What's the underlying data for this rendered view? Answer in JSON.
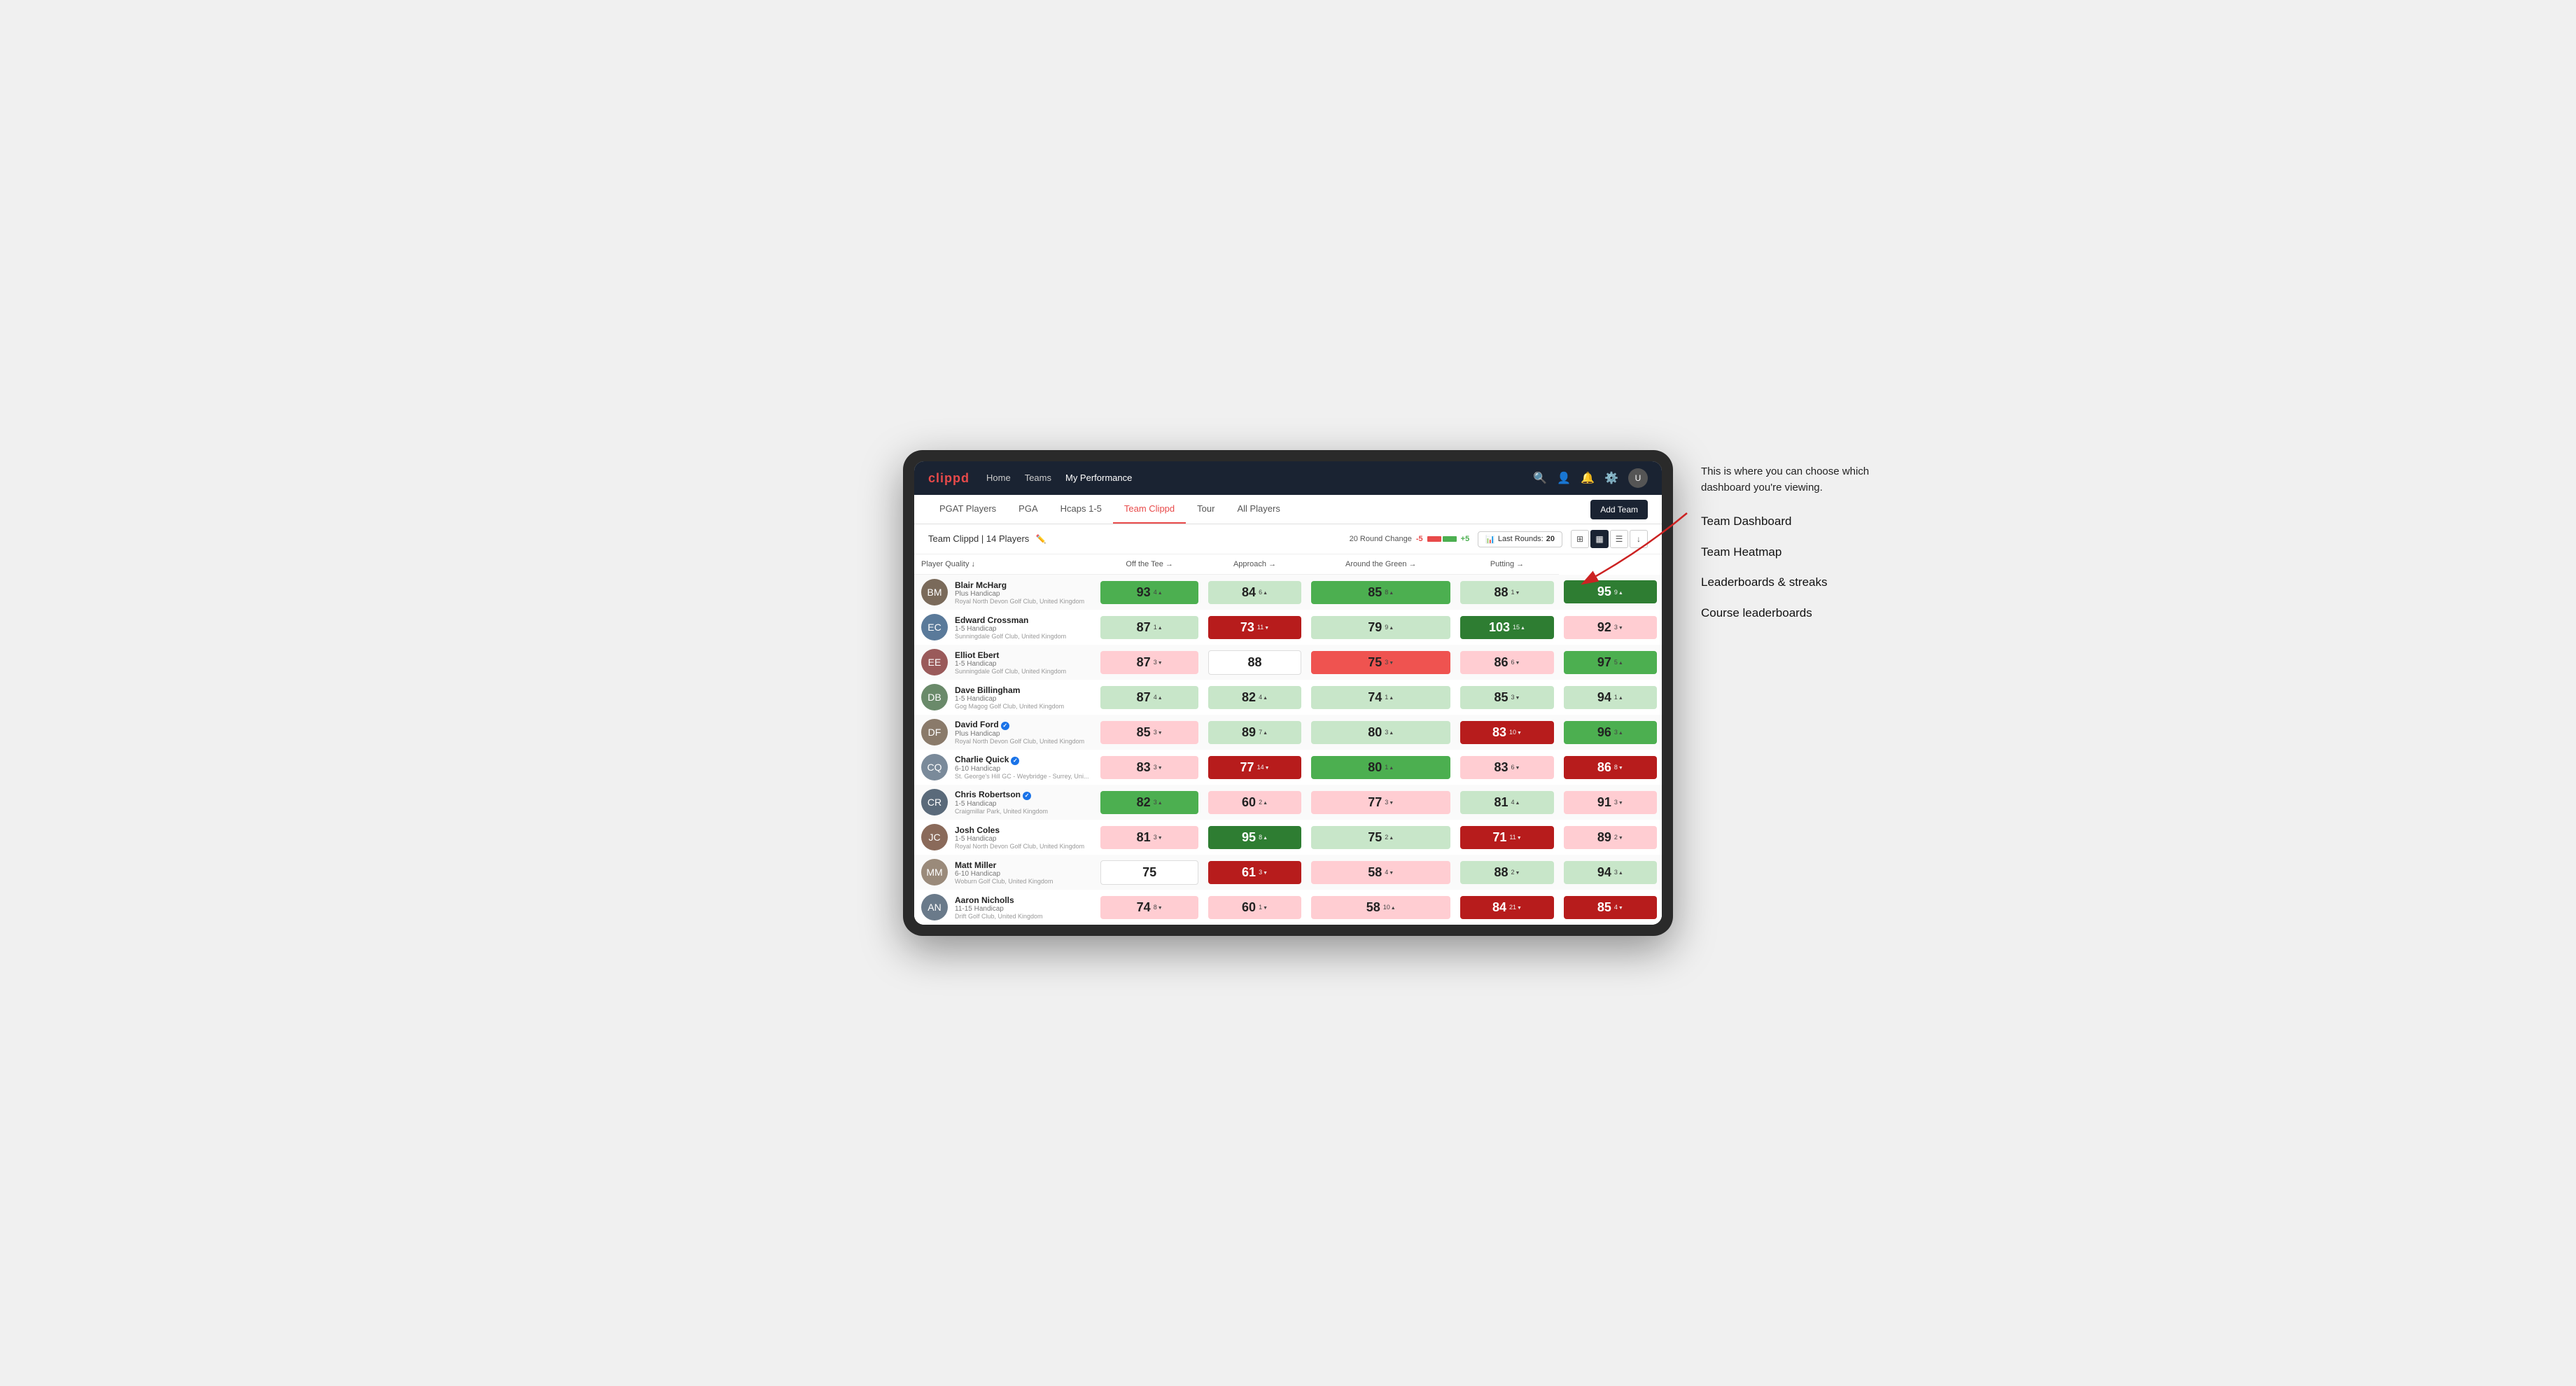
{
  "annotation": {
    "intro": "This is where you can choose which dashboard you're viewing.",
    "items": [
      "Team Dashboard",
      "Team Heatmap",
      "Leaderboards & streaks",
      "Course leaderboards"
    ]
  },
  "nav": {
    "logo": "clippd",
    "links": [
      "Home",
      "Teams",
      "My Performance"
    ],
    "active_link": "My Performance"
  },
  "sub_tabs": [
    "PGAT Players",
    "PGA",
    "Hcaps 1-5",
    "Team Clippd",
    "Tour",
    "All Players"
  ],
  "active_tab": "Team Clippd",
  "add_team_label": "Add Team",
  "team_header": {
    "name": "Team Clippd",
    "player_count": "14 Players",
    "round_change_label": "20 Round Change",
    "change_min": "-5",
    "change_max": "+5",
    "last_rounds_label": "Last Rounds:",
    "last_rounds_value": "20"
  },
  "table_headers": {
    "player": "Player Quality ↓",
    "off_tee": "Off the Tee →",
    "approach": "Approach →",
    "around_green": "Around the Green →",
    "putting": "Putting →"
  },
  "players": [
    {
      "name": "Blair McHarg",
      "handicap": "Plus Handicap",
      "club": "Royal North Devon Golf Club, United Kingdom",
      "avatar_color": "#7a6a5a",
      "player_quality": {
        "score": 93,
        "delta": 4,
        "dir": "up",
        "color": "green"
      },
      "off_tee": {
        "score": 84,
        "delta": 6,
        "dir": "up",
        "color": "light-green"
      },
      "approach": {
        "score": 85,
        "delta": 8,
        "dir": "up",
        "color": "green"
      },
      "around_green": {
        "score": 88,
        "delta": 1,
        "dir": "down",
        "color": "light-green"
      },
      "putting": {
        "score": 95,
        "delta": 9,
        "dir": "up",
        "color": "dark-green"
      }
    },
    {
      "name": "Edward Crossman",
      "handicap": "1-5 Handicap",
      "club": "Sunningdale Golf Club, United Kingdom",
      "avatar_color": "#5a7a9a",
      "player_quality": {
        "score": 87,
        "delta": 1,
        "dir": "up",
        "color": "light-green"
      },
      "off_tee": {
        "score": 73,
        "delta": 11,
        "dir": "down",
        "color": "dark-red"
      },
      "approach": {
        "score": 79,
        "delta": 9,
        "dir": "up",
        "color": "light-green"
      },
      "around_green": {
        "score": 103,
        "delta": 15,
        "dir": "up",
        "color": "dark-green"
      },
      "putting": {
        "score": 92,
        "delta": 3,
        "dir": "down",
        "color": "light-red"
      }
    },
    {
      "name": "Elliot Ebert",
      "handicap": "1-5 Handicap",
      "club": "Sunningdale Golf Club, United Kingdom",
      "avatar_color": "#9a5a5a",
      "player_quality": {
        "score": 87,
        "delta": 3,
        "dir": "down",
        "color": "light-red"
      },
      "off_tee": {
        "score": 88,
        "delta": null,
        "dir": null,
        "color": "white"
      },
      "approach": {
        "score": 75,
        "delta": 3,
        "dir": "down",
        "color": "red"
      },
      "around_green": {
        "score": 86,
        "delta": 6,
        "dir": "down",
        "color": "light-red"
      },
      "putting": {
        "score": 97,
        "delta": 5,
        "dir": "up",
        "color": "green"
      }
    },
    {
      "name": "Dave Billingham",
      "handicap": "1-5 Handicap",
      "club": "Gog Magog Golf Club, United Kingdom",
      "avatar_color": "#6a8a6a",
      "player_quality": {
        "score": 87,
        "delta": 4,
        "dir": "up",
        "color": "light-green"
      },
      "off_tee": {
        "score": 82,
        "delta": 4,
        "dir": "up",
        "color": "light-green"
      },
      "approach": {
        "score": 74,
        "delta": 1,
        "dir": "up",
        "color": "light-green"
      },
      "around_green": {
        "score": 85,
        "delta": 3,
        "dir": "down",
        "color": "light-green"
      },
      "putting": {
        "score": 94,
        "delta": 1,
        "dir": "up",
        "color": "light-green"
      }
    },
    {
      "name": "David Ford",
      "handicap": "Plus Handicap",
      "club": "Royal North Devon Golf Club, United Kingdom",
      "avatar_color": "#8a7a6a",
      "verified": true,
      "player_quality": {
        "score": 85,
        "delta": 3,
        "dir": "down",
        "color": "light-red"
      },
      "off_tee": {
        "score": 89,
        "delta": 7,
        "dir": "up",
        "color": "light-green"
      },
      "approach": {
        "score": 80,
        "delta": 3,
        "dir": "up",
        "color": "light-green"
      },
      "around_green": {
        "score": 83,
        "delta": 10,
        "dir": "down",
        "color": "dark-red"
      },
      "putting": {
        "score": 96,
        "delta": 3,
        "dir": "up",
        "color": "green"
      }
    },
    {
      "name": "Charlie Quick",
      "handicap": "6-10 Handicap",
      "club": "St. George's Hill GC - Weybridge - Surrey, Uni...",
      "avatar_color": "#7a8a9a",
      "verified": true,
      "player_quality": {
        "score": 83,
        "delta": 3,
        "dir": "down",
        "color": "light-red"
      },
      "off_tee": {
        "score": 77,
        "delta": 14,
        "dir": "down",
        "color": "dark-red"
      },
      "approach": {
        "score": 80,
        "delta": 1,
        "dir": "up",
        "color": "green"
      },
      "around_green": {
        "score": 83,
        "delta": 6,
        "dir": "down",
        "color": "light-red"
      },
      "putting": {
        "score": 86,
        "delta": 8,
        "dir": "down",
        "color": "dark-red"
      }
    },
    {
      "name": "Chris Robertson",
      "handicap": "1-5 Handicap",
      "club": "Craigmillar Park, United Kingdom",
      "avatar_color": "#5a6a7a",
      "verified": true,
      "player_quality": {
        "score": 82,
        "delta": 3,
        "dir": "up",
        "color": "green"
      },
      "off_tee": {
        "score": 60,
        "delta": 2,
        "dir": "up",
        "color": "light-red"
      },
      "approach": {
        "score": 77,
        "delta": 3,
        "dir": "down",
        "color": "light-red"
      },
      "around_green": {
        "score": 81,
        "delta": 4,
        "dir": "up",
        "color": "light-green"
      },
      "putting": {
        "score": 91,
        "delta": 3,
        "dir": "down",
        "color": "light-red"
      }
    },
    {
      "name": "Josh Coles",
      "handicap": "1-5 Handicap",
      "club": "Royal North Devon Golf Club, United Kingdom",
      "avatar_color": "#8a6a5a",
      "player_quality": {
        "score": 81,
        "delta": 3,
        "dir": "down",
        "color": "light-red"
      },
      "off_tee": {
        "score": 95,
        "delta": 8,
        "dir": "up",
        "color": "dark-green"
      },
      "approach": {
        "score": 75,
        "delta": 2,
        "dir": "up",
        "color": "light-green"
      },
      "around_green": {
        "score": 71,
        "delta": 11,
        "dir": "down",
        "color": "dark-red"
      },
      "putting": {
        "score": 89,
        "delta": 2,
        "dir": "down",
        "color": "light-red"
      }
    },
    {
      "name": "Matt Miller",
      "handicap": "6-10 Handicap",
      "club": "Woburn Golf Club, United Kingdom",
      "avatar_color": "#9a8a7a",
      "player_quality": {
        "score": 75,
        "delta": null,
        "dir": null,
        "color": "white"
      },
      "off_tee": {
        "score": 61,
        "delta": 3,
        "dir": "down",
        "color": "dark-red"
      },
      "approach": {
        "score": 58,
        "delta": 4,
        "dir": "down",
        "color": "light-red"
      },
      "around_green": {
        "score": 88,
        "delta": 2,
        "dir": "down",
        "color": "light-green"
      },
      "putting": {
        "score": 94,
        "delta": 3,
        "dir": "up",
        "color": "light-green"
      }
    },
    {
      "name": "Aaron Nicholls",
      "handicap": "11-15 Handicap",
      "club": "Drift Golf Club, United Kingdom",
      "avatar_color": "#6a7a8a",
      "player_quality": {
        "score": 74,
        "delta": 8,
        "dir": "down",
        "color": "light-red"
      },
      "off_tee": {
        "score": 60,
        "delta": 1,
        "dir": "down",
        "color": "light-red"
      },
      "approach": {
        "score": 58,
        "delta": 10,
        "dir": "up",
        "color": "light-red"
      },
      "around_green": {
        "score": 84,
        "delta": 21,
        "dir": "down",
        "color": "dark-red"
      },
      "putting": {
        "score": 85,
        "delta": 4,
        "dir": "down",
        "color": "dark-red"
      }
    }
  ]
}
